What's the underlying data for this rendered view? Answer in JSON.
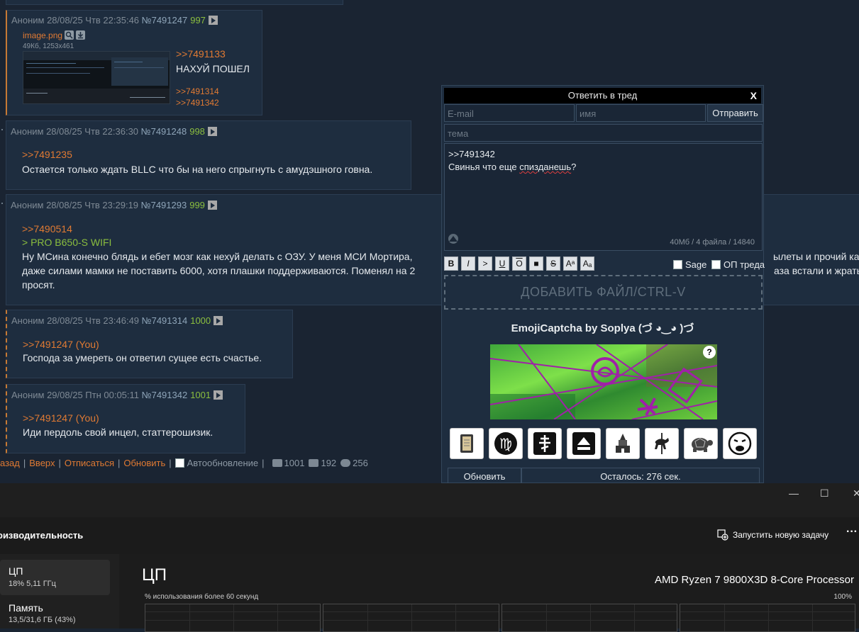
{
  "posts": [
    {
      "header": "Аноним 28/08/25 Чтв 22:35:46",
      "number": "№7491247",
      "count": "997",
      "file": {
        "name": "image.png",
        "info": "49Кб, 1253x461"
      },
      "reply": ">>7491133",
      "text": "НАХУЙ ПОШЕЛ",
      "backlinks": [
        ">>7491314",
        ">>7491342"
      ]
    },
    {
      "header": "Аноним 28/08/25 Чтв 22:36:30",
      "number": "№7491248",
      "count": "998",
      "reply": ">>7491235",
      "text": "Остается только ждать BLLC что бы на него спрыгнуть с амудэшного говна."
    },
    {
      "header": "Аноним 28/08/25 Чтв 23:29:19",
      "number": "№7491293",
      "count": "999",
      "reply": ">>7490514",
      "quote": "> PRO B650-S WIFI",
      "text_line1": "Ну МСина конечно блядь и ебет мозг как нехуй делать с ОЗУ. У меня МСИ Мортира,",
      "text_line1_right": "ылеты и прочий кал",
      "text_line2": "даже силами мамки не поставить 6000, хотя плашки поддерживаются. Поменял на 2",
      "text_line2_right": "аза встали и жрать",
      "text_line3": "просят."
    },
    {
      "header": "Аноним 28/08/25 Чтв 23:46:49",
      "number": "№7491314",
      "count": "1000",
      "reply": ">>7491247 (You)",
      "text": "Господа за умереть он ответил сущее есть счастье."
    },
    {
      "header": "Аноним 29/08/25 Птн 00:05:11",
      "number": "№7491342",
      "count": "1001",
      "reply": ">>7491247 (You)",
      "text": "Иди пердоль свой инцел, статтерошизик."
    }
  ],
  "nav": {
    "back": "азад",
    "up": "Вверх",
    "unsubscribe": "Отписаться",
    "refresh": "Обновить",
    "autorefresh": "Автообновление",
    "posts_count": "1001",
    "images_count": "192",
    "users_count": "256"
  },
  "reply_form": {
    "title": "Ответить в тред",
    "close": "X",
    "email_placeholder": "E-mail",
    "name_placeholder": "имя",
    "submit": "Отправить",
    "subject_placeholder": "тема",
    "message_line1": ">>7491342",
    "message_line2_a": "Свинья что еще ",
    "message_line2_b": "спизданешь",
    "message_line2_c": "?",
    "limits": "40Мб / 4 файла / 14840",
    "toolbar": [
      "B",
      "I",
      ">",
      "U",
      "O",
      "■",
      "S",
      "Aᵃ",
      "Aₐ"
    ],
    "sage": "Sage",
    "op": "ОП треда",
    "dropzone": "ДОБАВИТЬ ФАЙЛ/CTRL-V",
    "captcha_title": "EmojiCaptcha by Soplya (づ ◕‿◕ )づ",
    "captcha_help": "?",
    "emoji_options": [
      "notebook",
      "virgo",
      "orthodox-cross",
      "eject",
      "hindu-temple",
      "carousel-horse",
      "turtle",
      "weary-face"
    ],
    "refresh": "Обновить",
    "timer": "Осталось: 276 сек."
  },
  "taskmgr": {
    "controls": [
      "—",
      "☐",
      "✕"
    ],
    "section": "оизводительность",
    "new_task": "Запустить новую задачу",
    "more": "···",
    "cpu_label": "ЦП",
    "cpu_stats": "18%  5,11 ГГц",
    "mem_label": "Память",
    "mem_stats": "13,5/31,6 ГБ (43%)",
    "cpu_title": "ЦП",
    "cpu_model": "AMD Ryzen 7 9800X3D 8-Core Processor",
    "util_label": "% использования более 60 секунд",
    "util_max": "100%"
  }
}
